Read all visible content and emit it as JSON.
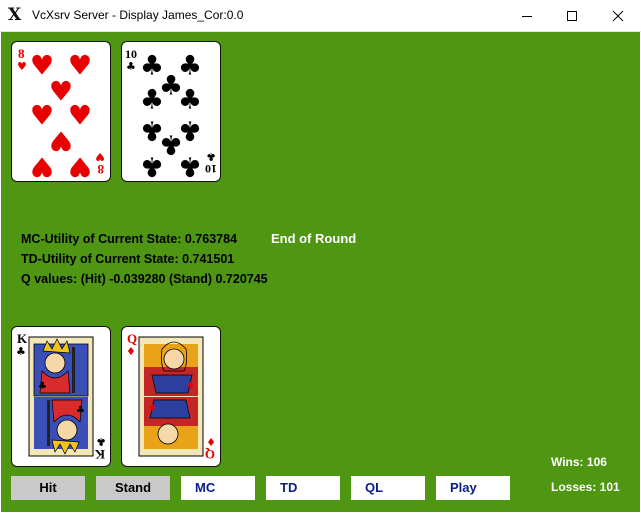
{
  "window": {
    "title": "VcXsrv Server - Display James_Cor:0.0",
    "icon": "x-logo-icon"
  },
  "dealer_hand": [
    {
      "rank": "8",
      "suit": "hearts",
      "suit_symbol": "♥"
    },
    {
      "rank": "10",
      "suit": "clubs",
      "suit_symbol": "♣"
    }
  ],
  "player_hand": [
    {
      "rank": "K",
      "suit": "clubs",
      "suit_symbol": "♣"
    },
    {
      "rank": "Q",
      "suit": "diamonds",
      "suit_symbol": "♦"
    }
  ],
  "info": {
    "mc_utility": "MC-Utility of Current State: 0.763784",
    "td_utility": "TD-Utility of Current State: 0.741501",
    "q_values": "Q values: (Hit) -0.039280 (Stand) 0.720745",
    "status": "End of Round"
  },
  "buttons": {
    "hit": "Hit",
    "stand": "Stand",
    "mc": "MC",
    "td": "TD",
    "ql": "QL",
    "play": "Play"
  },
  "score": {
    "wins": "Wins: 106",
    "losses": "Losses: 101"
  },
  "colors": {
    "table": "#4f9612",
    "red_suit": "#e80000",
    "black_suit": "#000000",
    "button_text": "#0b1c8c"
  }
}
